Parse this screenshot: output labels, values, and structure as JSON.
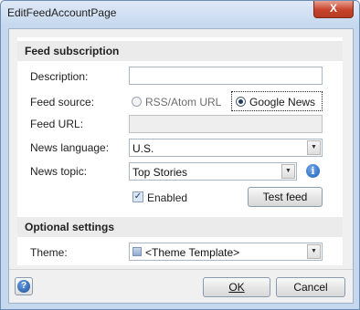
{
  "window": {
    "title": "EditFeedAccountPage",
    "close_glyph": "X"
  },
  "feed_section": {
    "header": "Feed subscription",
    "description_label": "Description:",
    "description_value": "",
    "feed_source_label": "Feed source:",
    "source_options": [
      {
        "label": "RSS/Atom URL",
        "selected": false
      },
      {
        "label": "Google News",
        "selected": true
      }
    ],
    "feed_url_label": "Feed URL:",
    "feed_url_value": "",
    "news_language_label": "News language:",
    "news_language_value": "U.S.",
    "news_topic_label": "News topic:",
    "news_topic_value": "Top Stories",
    "enabled_label": "Enabled",
    "enabled_checked": true,
    "test_feed_label": "Test feed"
  },
  "optional_section": {
    "header": "Optional settings",
    "theme_label": "Theme:",
    "theme_value": "<Theme Template>"
  },
  "footer": {
    "ok_label": "OK",
    "cancel_label": "Cancel"
  },
  "icons": {
    "info": "info-icon",
    "help": "help-icon",
    "close": "close-icon",
    "dropdown": "chevron-down-icon",
    "check": "checkmark-icon"
  },
  "colors": {
    "frame": "#c6d8ee",
    "section_header_bg": "#ebebeb",
    "close_button": "#c7432b"
  }
}
